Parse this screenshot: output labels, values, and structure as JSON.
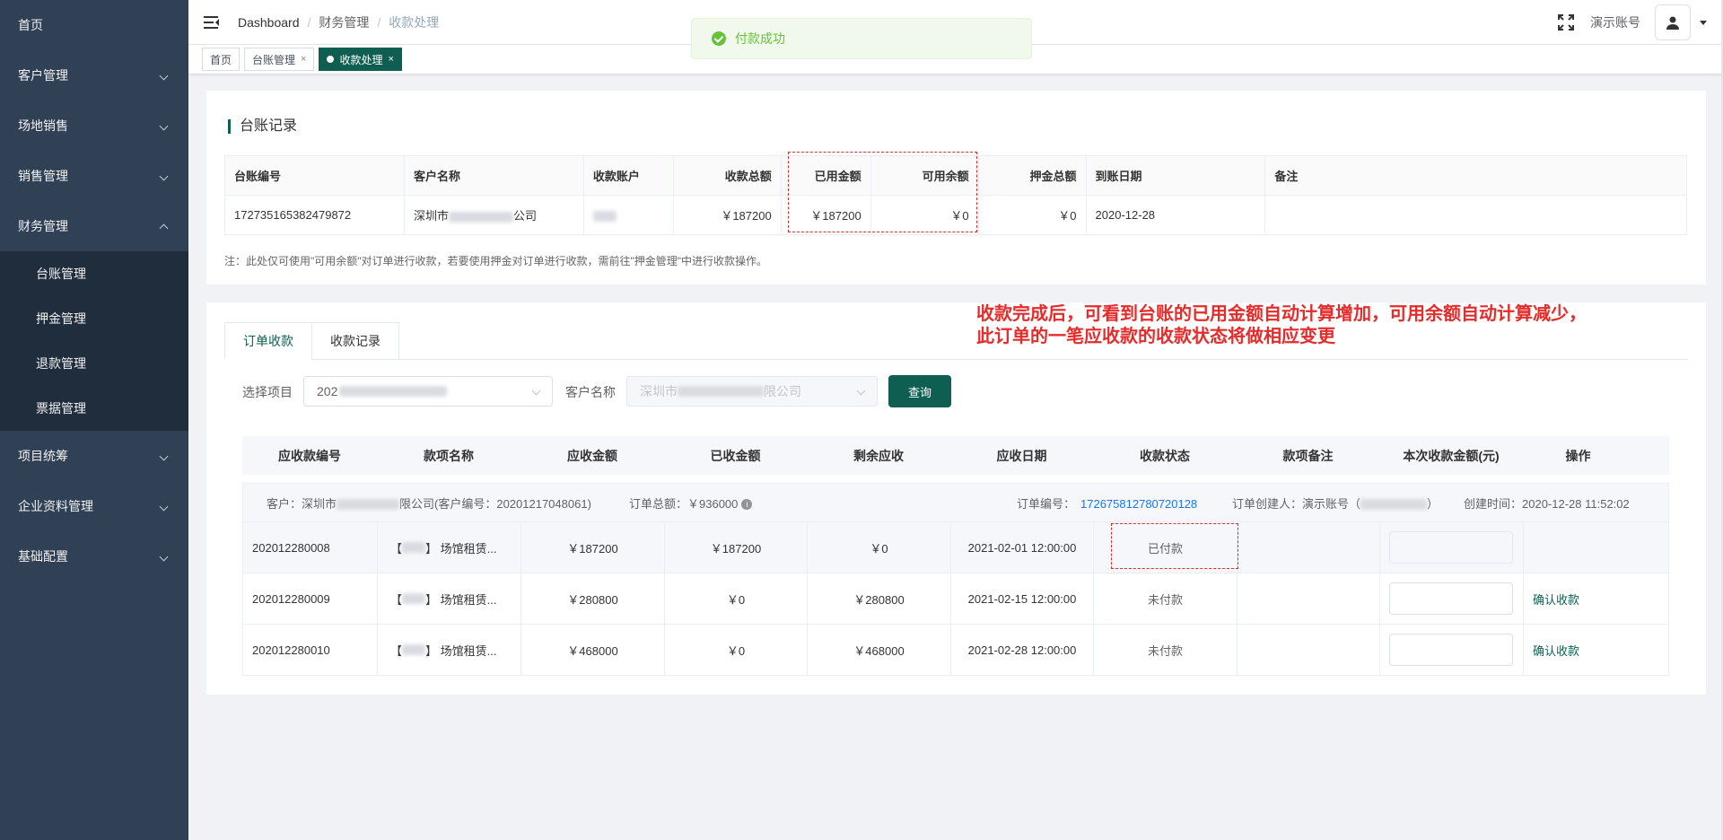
{
  "sidebar": {
    "items": [
      {
        "label": "首页",
        "has_arrow": false
      },
      {
        "label": "客户管理",
        "has_arrow": true
      },
      {
        "label": "场地销售",
        "has_arrow": true
      },
      {
        "label": "销售管理",
        "has_arrow": true
      },
      {
        "label": "财务管理",
        "has_arrow": true,
        "expanded": true
      }
    ],
    "sub_items": [
      "台账管理",
      "押金管理",
      "退款管理",
      "票据管理"
    ],
    "items_after": [
      {
        "label": "项目统筹"
      },
      {
        "label": "企业资料管理"
      },
      {
        "label": "基础配置"
      }
    ]
  },
  "header": {
    "breadcrumb": [
      "Dashboard",
      "财务管理",
      "收款处理"
    ],
    "account_name": "演示账号"
  },
  "tags": [
    {
      "label": "首页",
      "closable": false,
      "active": false
    },
    {
      "label": "台账管理",
      "closable": true,
      "active": false
    },
    {
      "label": "收款处理",
      "closable": true,
      "active": true
    }
  ],
  "toast": {
    "message": "付款成功",
    "color": "#67c23a"
  },
  "ledger_card": {
    "title": "台账记录",
    "columns": [
      "台账编号",
      "客户名称",
      "收款账户",
      "收款总额",
      "已用金额",
      "可用余额",
      "押金总额",
      "到账日期",
      "备注"
    ],
    "row": {
      "id": "172735165382479872",
      "customer_prefix": "深圳市",
      "customer_suffix": "公司",
      "account": "",
      "total": "￥187200",
      "used": "￥187200",
      "available": "￥0",
      "deposit": "￥0",
      "date": "2020-12-28",
      "remark": ""
    },
    "note": "注：此处仅可使用\"可用余额\"对订单进行收款，若要使用押金对订单进行收款，需前往\"押金管理\"中进行收款操作。"
  },
  "order_card": {
    "tabs": [
      "订单收款",
      "收款记录"
    ],
    "filters": {
      "project_label": "选择项目",
      "project_value": "202",
      "customer_label": "客户名称",
      "customer_value_prefix": "深圳市",
      "customer_value_suffix": "限公司",
      "query_button": "查询"
    },
    "columns": [
      "应收款编号",
      "款项名称",
      "应收金额",
      "已收金额",
      "剩余应收",
      "应收日期",
      "收款状态",
      "款项备注",
      "本次收款金额(元)",
      "操作"
    ],
    "group": {
      "customer_prefix": "客户：深圳市",
      "customer_suffix": "限公司(客户编号：20201217048061)",
      "order_total_label": "订单总额：￥936000",
      "order_no_label": "订单编号：",
      "order_no": "172675812780720128",
      "creator_label": "订单创建人：演示账号（",
      "creator_suffix": "）",
      "created_time": "创建时间：2020-12-28 11:52:02"
    },
    "rows": [
      {
        "no": "202012280008",
        "name_prefix": "【",
        "name_suffix": "】 场馆租赁...",
        "receivable": "￥187200",
        "received": "￥187200",
        "remaining": "￥0",
        "due_date": "2021-02-01 12:00:00",
        "status": "已付款",
        "remark": "",
        "action": ""
      },
      {
        "no": "202012280009",
        "name_prefix": "【",
        "name_suffix": "】 场馆租赁...",
        "receivable": "￥280800",
        "received": "￥0",
        "remaining": "￥280800",
        "due_date": "2021-02-15 12:00:00",
        "status": "未付款",
        "remark": "",
        "action": "确认收款"
      },
      {
        "no": "202012280010",
        "name_prefix": "【",
        "name_suffix": "】 场馆租赁...",
        "receivable": "￥468000",
        "received": "￥0",
        "remaining": "￥468000",
        "due_date": "2021-02-28 12:00:00",
        "status": "未付款",
        "remark": "",
        "action": "确认收款"
      }
    ]
  },
  "annotation": {
    "line1": "收款完成后，可看到台账的已用金额自动计算增加，可用余额自动计算减少，",
    "line2": "此订单的一笔应收款的收款状态将做相应变更",
    "color": "#e62b2b"
  },
  "theme": {
    "sidebar_bg": "#304156",
    "primary": "#0e5e52"
  }
}
